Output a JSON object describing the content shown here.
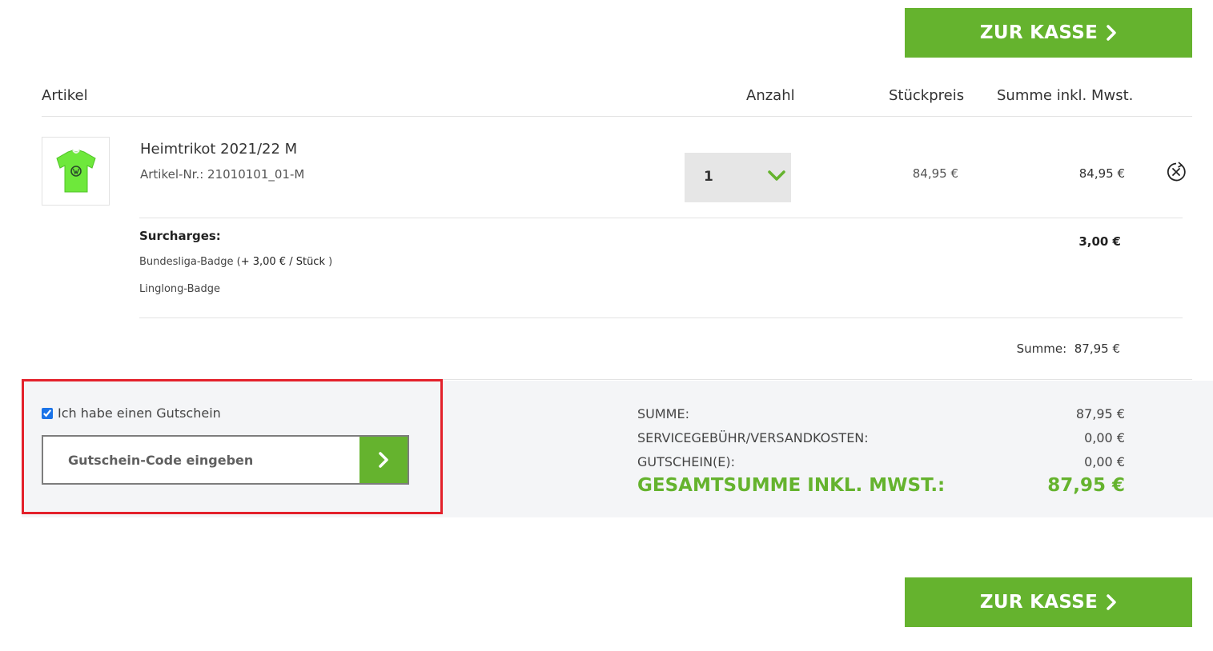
{
  "checkout": {
    "button_label": "ZUR KASSE",
    "chevron_icon": "chevron-right-icon"
  },
  "table": {
    "headers": {
      "article": "Artikel",
      "quantity": "Anzahl",
      "unit_price": "Stückpreis",
      "total": "Summe inkl. Mwst."
    }
  },
  "item": {
    "name": "Heimtrikot 2021/22 M",
    "article_number": "Artikel-Nr.: 21010101_01-M",
    "quantity": "1",
    "unit_price": "84,95 €",
    "line_total": "84,95 €",
    "remove_icon": "remove-circle-x-icon",
    "image_icon": "green-jersey-image"
  },
  "surcharges": {
    "title": "Surcharges:",
    "badge1_name": "Bundesliga-Badge",
    "badge1_open": "(",
    "badge1_price": "+ 3,00 € / Stück",
    "badge1_close": ")",
    "badge2_name": "Linglong-Badge",
    "total": "3,00 €"
  },
  "subtotal": {
    "label": "Summe:",
    "value": "87,95 €"
  },
  "voucher": {
    "checkbox_label": "Ich habe einen Gutschein",
    "checked": true,
    "placeholder": "Gutschein-Code eingeben"
  },
  "summary": {
    "rows": [
      {
        "label": "SUMME:",
        "value": "87,95 €"
      },
      {
        "label": "SERVICEGEBÜHR/VERSANDKOSTEN:",
        "value": "0,00 €"
      },
      {
        "label": "GUTSCHEIN(E):",
        "value": "0,00 €"
      }
    ],
    "grand_total_label": "GESAMTSUMME INKL. MWST.:",
    "grand_total_value": "87,95 €"
  },
  "colors": {
    "accent_green": "#65b32e",
    "highlight_red": "#e3212b",
    "summary_bg": "#f4f5f7"
  }
}
